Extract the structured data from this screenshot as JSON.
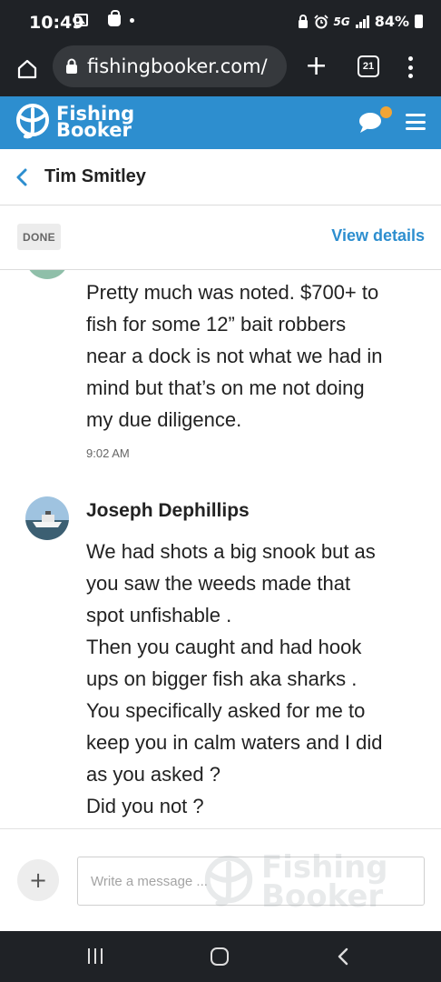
{
  "status_bar": {
    "time": "10:49",
    "network": "5G",
    "battery": "84%"
  },
  "browser": {
    "url": "fishingbooker.com/",
    "tab_count": "21"
  },
  "site": {
    "logo_line1": "Fishing",
    "logo_line2": "Booker",
    "accent_color": "#2d8ecf",
    "notification_color": "#f2a535"
  },
  "conversation": {
    "name": "Tim Smitley",
    "status_badge": "DONE",
    "view_details": "View details"
  },
  "messages": [
    {
      "text": "Pretty much was noted. $700+ to\nfish for some 12” bait robbers\nnear a dock is not what we had in\nmind but that’s on me not doing\nmy due diligence.",
      "time": "9:02 AM"
    },
    {
      "sender": "Joseph Dephillips",
      "text": "We had shots a big snook but as\nyou saw the weeds made that\nspot unfishable .\nThen you caught and had hook\nups on bigger fish aka sharks .\nYou specifically asked for me to\nkeep you in calm waters and I did\nas you asked ?\nDid you not ?"
    }
  ],
  "compose": {
    "attach_label": "+",
    "placeholder": "Write a message ..."
  },
  "watermark": {
    "line1": "Fishing",
    "line2": "Booker"
  }
}
